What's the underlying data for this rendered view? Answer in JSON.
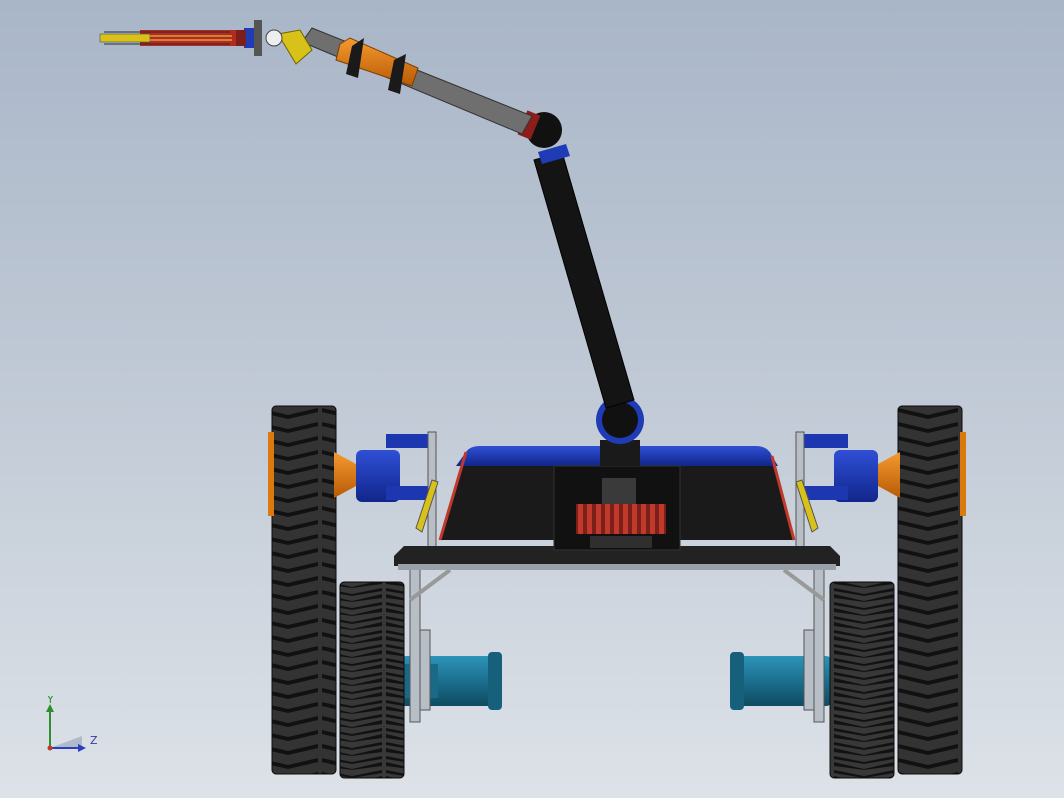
{
  "viewport": {
    "background_top": "#a9b6c8",
    "background_bottom": "#dde2e8"
  },
  "triad": {
    "y_label": "Y",
    "z_label": "Z",
    "y_color": "#2f8f2f",
    "z_color": "#2a3fbf"
  },
  "model": {
    "colors": {
      "tire": "#2a2a2a",
      "tread": "#111111",
      "body_blue": "#1f3bb5",
      "chassis": "#1b1b1b",
      "arm_black": "#141414",
      "arm_gray": "#6f6f6f",
      "orange": "#e07a10",
      "teal": "#1e6e8c",
      "gear_red": "#c0392b",
      "yellow": "#d8c21a"
    }
  }
}
